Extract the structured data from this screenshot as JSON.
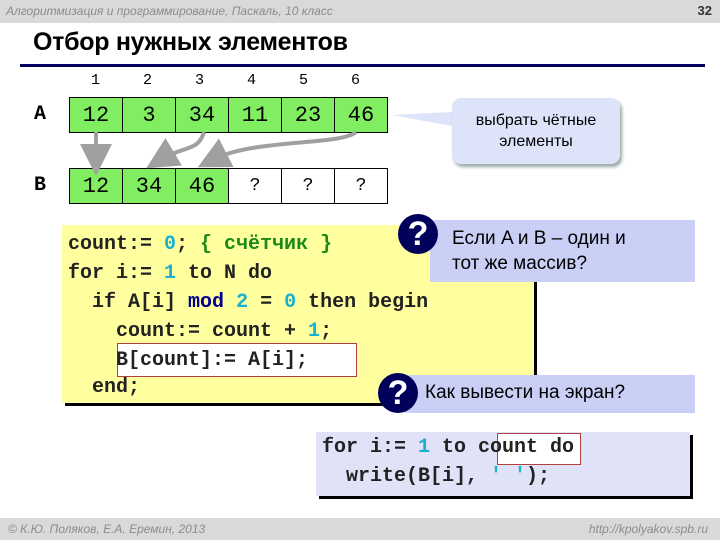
{
  "header": {
    "course": "Алгоритмизация и программирование, Паскаль, 10 класс",
    "page_number": "32"
  },
  "title": "Отбор нужных элементов",
  "indices": [
    "1",
    "2",
    "3",
    "4",
    "5",
    "6"
  ],
  "array_a": {
    "label": "A",
    "values": [
      "12",
      "3",
      "34",
      "11",
      "23",
      "46"
    ]
  },
  "array_b": {
    "label": "B",
    "values": [
      "12",
      "34",
      "46",
      "?",
      "?",
      "?"
    ]
  },
  "callout": {
    "line1": "выбрать чётные",
    "line2": "элементы"
  },
  "code_main": {
    "l1_a": "count:= ",
    "l1_num": "0",
    "l1_b": "; ",
    "l1_comment": "{ счётчик }",
    "l2_a": "for i:= ",
    "l2_num": "1",
    "l2_b": " to N do",
    "l3_a": "  if A[i] ",
    "l3_mod": "mod",
    "l3_sp": " ",
    "l3_num": "2",
    "l3_b": " = ",
    "l3_num2": "0",
    "l3_c": " then begin",
    "l4_a": "    count:= count + ",
    "l4_num": "1",
    "l4_b": ";",
    "l5": "    B[count]:= A[i];",
    "l6": "  end;"
  },
  "question1": {
    "icon": "?",
    "line1": "Если A и B – один и",
    "line2": "тот же массив?"
  },
  "question2": {
    "icon": "?",
    "text": "Как вывести на экран?"
  },
  "code_output": {
    "l1_a": "for i:= ",
    "l1_num": "1",
    "l1_b": " to count do",
    "l2_a": "  write(B[i], ",
    "l2_str": "' '",
    "l2_b": ");"
  },
  "footer": {
    "copyright": "© К.Ю. Поляков, Е.А. Еремин, 2013",
    "url": "http://kpolyakov.spb.ru"
  }
}
